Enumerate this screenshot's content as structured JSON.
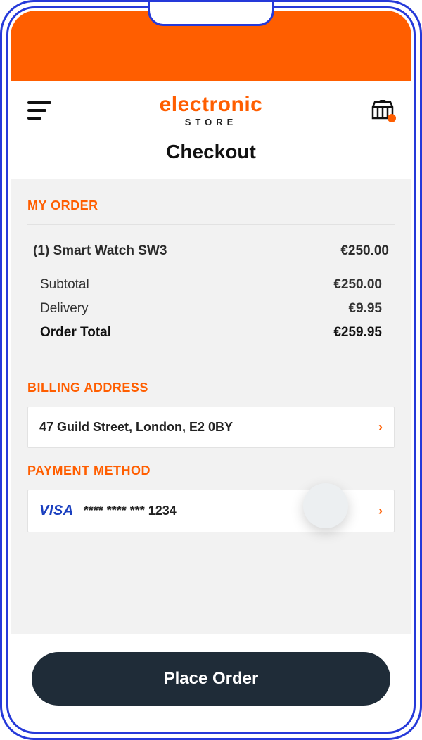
{
  "logo": {
    "main": "electronic",
    "sub": "STORE"
  },
  "page_title": "Checkout",
  "order": {
    "section": "MY ORDER",
    "item_label": "(1) Smart Watch SW3",
    "item_price": "€250.00",
    "subtotal_label": "Subtotal",
    "subtotal_value": "€250.00",
    "delivery_label": "Delivery",
    "delivery_value": "€9.95",
    "total_label": "Order Total",
    "total_value": "€259.95"
  },
  "billing": {
    "section": "BILLING ADDRESS",
    "address": "47 Guild Street, London, E2 0BY"
  },
  "payment": {
    "section": "PAYMENT METHOD",
    "brand": "VISA",
    "mask": "**** **** *** 1234"
  },
  "cta": "Place Order"
}
